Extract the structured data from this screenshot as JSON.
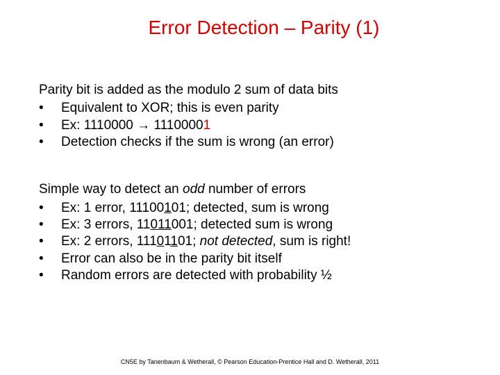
{
  "title": "Error Detection – Parity (1)",
  "section1": {
    "intro": "Parity bit is added as the modulo 2 sum of data bits",
    "b1": "Equivalent to XOR; this is even parity",
    "b2_a": "Ex: 1110000 ",
    "b2_arrow": "→",
    "b2_b": " 1110000",
    "b2_c": "1",
    "b3": "Detection checks if the sum is wrong (an error)"
  },
  "section2": {
    "intro_a": "Simple way to detect an ",
    "intro_b": "odd",
    "intro_c": " number of errors",
    "b1_a": "Ex: 1 error, 11100",
    "b1_b": "1",
    "b1_c": "01; detected, sum is wrong",
    "b2_a": "Ex: 3 errors, 11",
    "b2_b": "011",
    "b2_c": "001; detected sum is wrong",
    "b3_a": "Ex: 2 errors, 111",
    "b3_b": "0",
    "b3_c": "1",
    "b3_d": "1",
    "b3_e": "01; ",
    "b3_f": "not detected",
    "b3_g": ", sum is right!",
    "b4": "Error can also be in the parity bit itself",
    "b5": "Random errors are detected with probability ½"
  },
  "footer": "CN5E by Tanenbaum & Wetherall, © Pearson Education-Prentice Hall and D. Wetherall, 2011"
}
